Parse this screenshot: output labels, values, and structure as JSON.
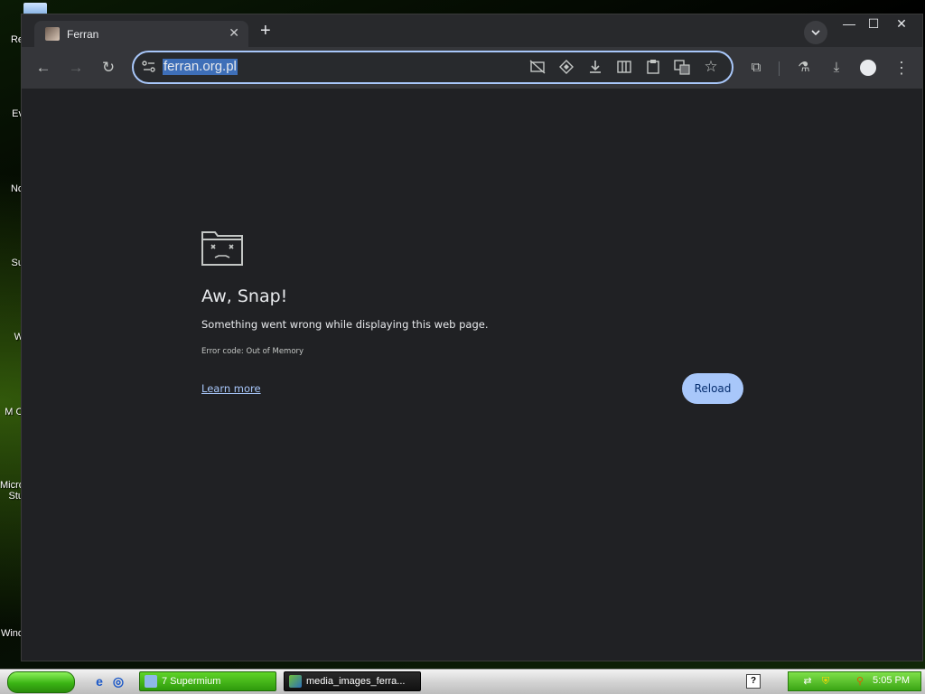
{
  "desktop": {
    "icons": [
      "Re",
      "Ev",
      "No",
      "Su",
      "W",
      "M O",
      "Micro Stu",
      "Wind"
    ]
  },
  "browser": {
    "tab": {
      "title": "Ferran",
      "close_glyph": "✕"
    },
    "new_tab_glyph": "+",
    "tab_search_glyph": "⌄",
    "window_controls": {
      "minimize": "—",
      "maximize": "☐",
      "close": "✕"
    },
    "nav": {
      "back": "←",
      "forward": "→",
      "reload": "↻"
    },
    "omnibox": {
      "url": "ferran.org.pl"
    },
    "toolbar_icons": {
      "star": "☆",
      "extensions": "⧉",
      "labs": "⚗",
      "downloads": "⤓",
      "menu": "⋮"
    }
  },
  "page": {
    "title": "Aw, Snap!",
    "message": "Something went wrong while displaying this web page.",
    "error_code": "Error code: Out of Memory",
    "learn_more": "Learn more",
    "reload": "Reload"
  },
  "taskbar": {
    "tasks": [
      {
        "label": "7 Supermium",
        "active": true
      },
      {
        "label": "media_images_ferra...",
        "active": false
      }
    ],
    "clock": "5:05 PM"
  },
  "colors": {
    "accent": "#a8c7fa",
    "page_bg": "#202124",
    "toolbar_bg": "#35363a",
    "url_highlight": "#3e6fb8"
  }
}
